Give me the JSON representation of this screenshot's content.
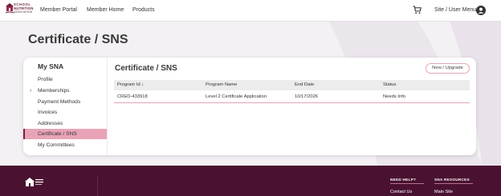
{
  "brand": {
    "logo_line1": "SCHOOL",
    "logo_line2": "NUTRITION",
    "logo_line3": "ASSOCIATION"
  },
  "top_nav": [
    {
      "label": "Member Portal"
    },
    {
      "label": "Member Home"
    },
    {
      "label": "Products"
    }
  ],
  "header": {
    "cart_icon": "cart-icon",
    "site_menu_label": "Site / User Menu",
    "user_icon": "user-circle-icon"
  },
  "page": {
    "title": "Certificate / SNS"
  },
  "sidebar": {
    "heading": "My SNA",
    "items": [
      {
        "label": "Profile"
      },
      {
        "label": "Memberships",
        "expandable": true
      },
      {
        "label": "Payment Methods"
      },
      {
        "label": "Invoices"
      },
      {
        "label": "Addresses"
      },
      {
        "label": "Certificate / SNS",
        "active": true
      },
      {
        "label": "My Committees"
      }
    ]
  },
  "content": {
    "title": "Certificate / SNS",
    "new_button": "New / Upgrade",
    "columns": [
      "Program Id ↓",
      "Program Name",
      "End Date",
      "Status"
    ],
    "rows": [
      [
        "CRED-433918",
        "Level 2 Certificate Application",
        "10/17/2026",
        "Needs Info"
      ]
    ]
  },
  "footer": {
    "need_help_heading": "NEED HELP?",
    "need_help_link": "Contact Us",
    "resources_heading": "SNA RESOURCES",
    "resources_link": "Main Site"
  },
  "colors": {
    "brand": "#6b1d3a",
    "active_item": "#e8a4b6",
    "footer_bg": "#4a1230"
  }
}
